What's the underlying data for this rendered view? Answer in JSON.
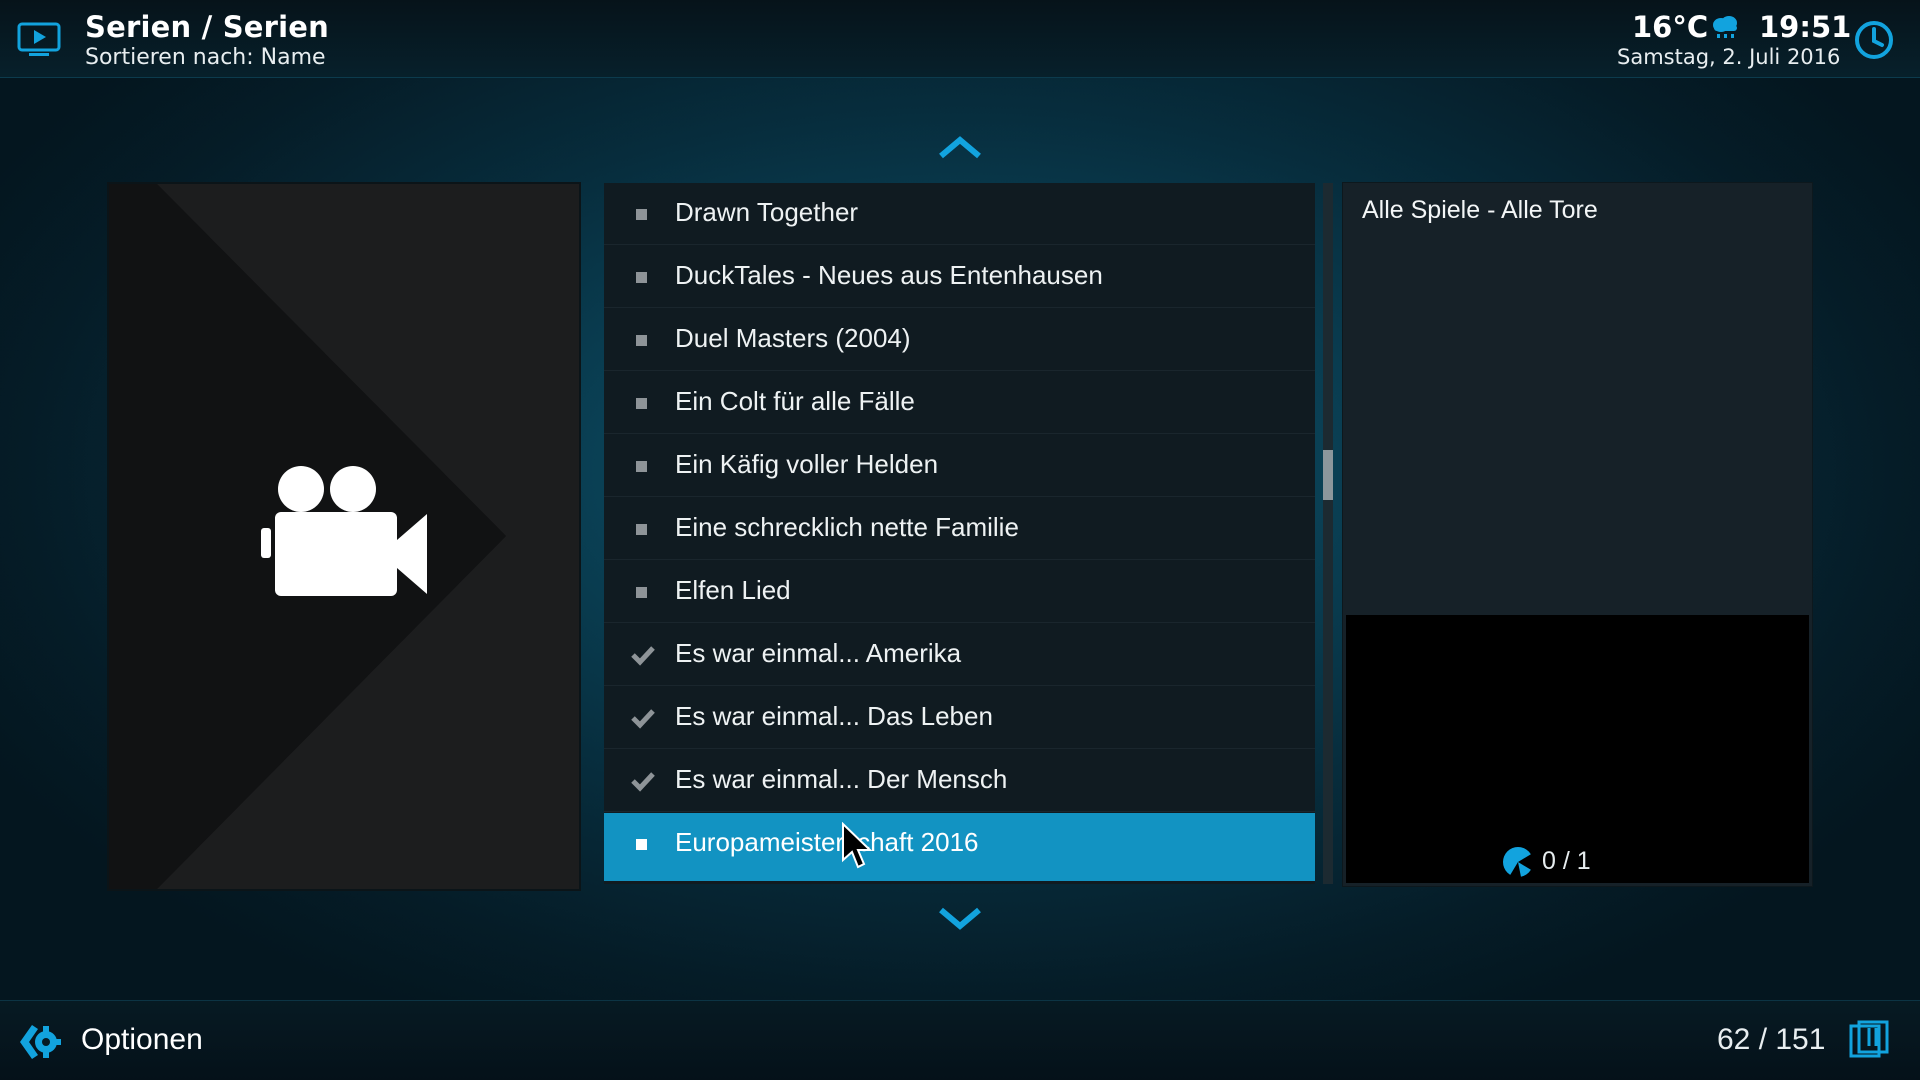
{
  "header": {
    "title": "Serien / Serien",
    "subtitle": "Sortieren nach: Name",
    "temperature": "16°C",
    "weather_icon": "rain-cloud-icon",
    "time": "19:51",
    "date": "Samstag, 2. Juli 2016"
  },
  "list": {
    "items": [
      {
        "label": "Drawn Together",
        "watched": false
      },
      {
        "label": "DuckTales - Neues aus Entenhausen",
        "watched": false
      },
      {
        "label": "Duel Masters (2004)",
        "watched": false
      },
      {
        "label": "Ein Colt für alle Fälle",
        "watched": false
      },
      {
        "label": "Ein Käfig voller Helden",
        "watched": false
      },
      {
        "label": "Eine schrecklich nette Familie",
        "watched": false
      },
      {
        "label": "Elfen Lied",
        "watched": false
      },
      {
        "label": "Es war einmal... Amerika",
        "watched": true
      },
      {
        "label": "Es war einmal... Das Leben",
        "watched": true
      },
      {
        "label": "Es war einmal... Der Mensch",
        "watched": true
      },
      {
        "label": "Europameisterschaft 2016",
        "watched": false,
        "selected": true
      }
    ],
    "scroll_position": 0.41
  },
  "info": {
    "title": "Alle Spiele - Alle Tore",
    "progress_text": "0 / 1"
  },
  "footer": {
    "options_label": "Optionen",
    "counter": "62 / 151"
  },
  "colors": {
    "accent": "#1293c2",
    "icon_blue": "#12a3de",
    "background": "#0a4257"
  }
}
